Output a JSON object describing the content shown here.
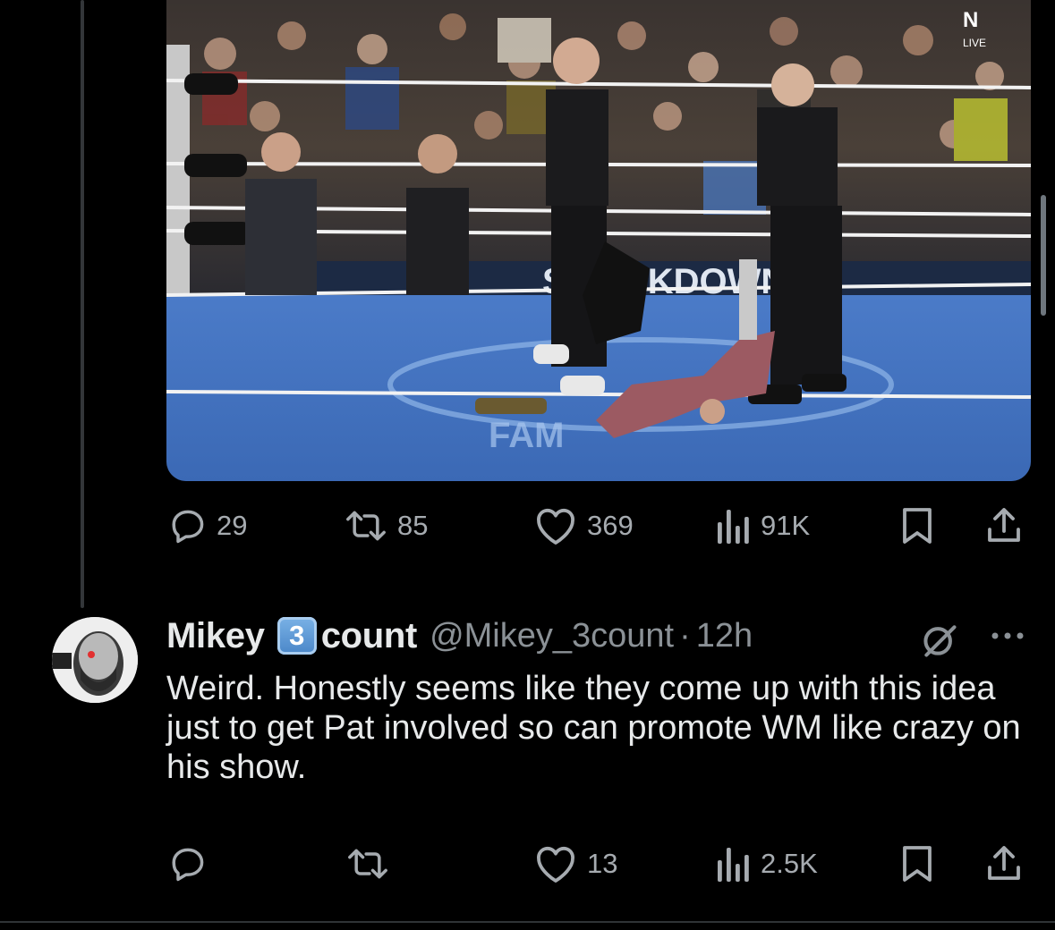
{
  "tweet": {
    "media": {
      "overlay_text": "N",
      "overlay_sub": "LIVE"
    },
    "actions": {
      "replies": "29",
      "reposts": "85",
      "likes": "369",
      "views": "91K"
    }
  },
  "reply": {
    "display_name_part1": "Mikey",
    "keycap_digit": "3",
    "display_name_part2": "count",
    "handle": "@Mikey_3count",
    "separator": "·",
    "time": "12h",
    "text": "Weird. Honestly seems like they come up with this idea just to get Pat involved so can promote WM like crazy on his show.",
    "actions": {
      "replies": "",
      "reposts": "",
      "likes": "13",
      "views": "2.5K"
    }
  },
  "icons": {
    "reply": "reply-icon",
    "repost": "repost-icon",
    "like": "heart-icon",
    "views": "views-icon",
    "bookmark": "bookmark-icon",
    "share": "share-icon",
    "grok": "grok-icon",
    "more": "more-icon"
  },
  "colors": {
    "background": "#000000",
    "text": "#e7e9ea",
    "muted": "#8b9196",
    "ring_mat": "#3f6fc0"
  }
}
